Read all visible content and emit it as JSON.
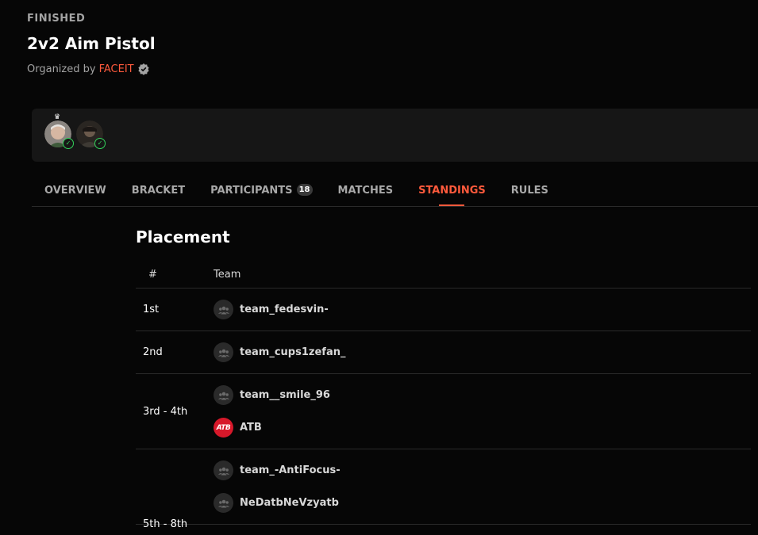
{
  "header": {
    "status": "FINISHED",
    "title": "2v2 Aim Pistol",
    "organized_by_label": "Organized by",
    "organizer": "FACEIT"
  },
  "tabs": [
    {
      "label": "OVERVIEW"
    },
    {
      "label": "BRACKET"
    },
    {
      "label": "PARTICIPANTS",
      "count": "18"
    },
    {
      "label": "MATCHES"
    },
    {
      "label": "STANDINGS",
      "active": true
    },
    {
      "label": "RULES"
    }
  ],
  "placement": {
    "title": "Placement",
    "columns": [
      "#",
      "Team"
    ],
    "rows": [
      {
        "rank": "1st",
        "teams": [
          "team_fedesvin-"
        ]
      },
      {
        "rank": "2nd",
        "teams": [
          "team_cups1zefan_"
        ]
      },
      {
        "rank": "3rd - 4th",
        "teams": [
          "team__smile_96",
          "ATB"
        ]
      },
      {
        "rank": "5th - 8th",
        "teams": [
          "team_-AntiFocus-",
          "NeDatbNeVzyatb"
        ]
      }
    ],
    "atb_logo_text": "ATB"
  },
  "colors": {
    "accent": "#ff5a3c",
    "online": "#32d35a",
    "background": "#060606",
    "panel": "#161616"
  }
}
